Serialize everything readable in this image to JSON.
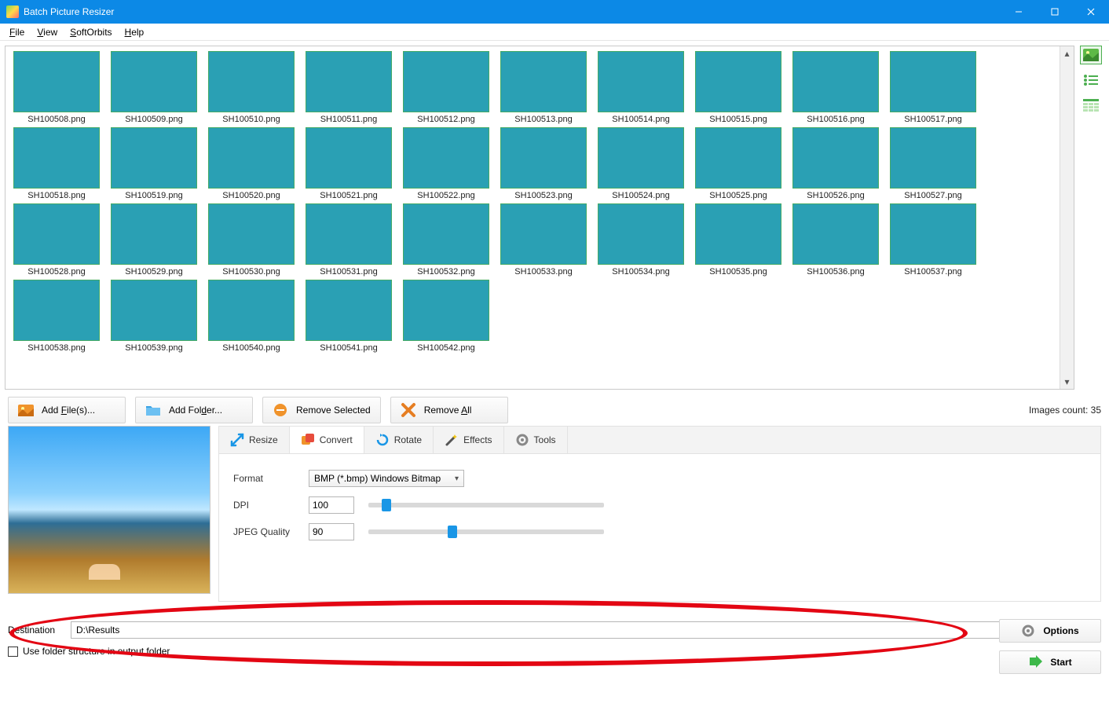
{
  "window": {
    "title": "Batch Picture Resizer"
  },
  "menu": {
    "file": "File",
    "view": "View",
    "softorbits": "SoftOrbits",
    "help": "Help"
  },
  "thumbnails": [
    {
      "name": "SH100508.png",
      "cls": "beach"
    },
    {
      "name": "SH100509.png",
      "cls": "sky"
    },
    {
      "name": "SH100510.png",
      "cls": "beach2"
    },
    {
      "name": "SH100511.png",
      "cls": "beach"
    },
    {
      "name": "SH100512.png",
      "cls": "beach"
    },
    {
      "name": "SH100513.png",
      "cls": "beach2"
    },
    {
      "name": "SH100514.png",
      "cls": "beach2"
    },
    {
      "name": "SH100515.png",
      "cls": "pier"
    },
    {
      "name": "SH100516.png",
      "cls": "water"
    },
    {
      "name": "SH100517.png",
      "cls": "water2"
    },
    {
      "name": "SH100518.png",
      "cls": "water"
    },
    {
      "name": "SH100519.png",
      "cls": "water2"
    },
    {
      "name": "SH100520.png",
      "cls": "water"
    },
    {
      "name": "SH100521.png",
      "cls": "water2"
    },
    {
      "name": "SH100522.png",
      "cls": "water"
    },
    {
      "name": "SH100523.png",
      "cls": "water2"
    },
    {
      "name": "SH100524.png",
      "cls": "water"
    },
    {
      "name": "SH100525.png",
      "cls": "water2"
    },
    {
      "name": "SH100526.png",
      "cls": "water"
    },
    {
      "name": "SH100527.png",
      "cls": "water2"
    },
    {
      "name": "SH100528.png",
      "cls": "water"
    },
    {
      "name": "SH100529.png",
      "cls": "pier"
    },
    {
      "name": "SH100530.png",
      "cls": "people"
    },
    {
      "name": "SH100531.png",
      "cls": "people"
    },
    {
      "name": "SH100532.png",
      "cls": "reef"
    },
    {
      "name": "SH100533.png",
      "cls": "reef"
    },
    {
      "name": "SH100534.png",
      "cls": "people"
    },
    {
      "name": "SH100535.png",
      "cls": "people"
    },
    {
      "name": "SH100536.png",
      "cls": "shore"
    },
    {
      "name": "SH100537.png",
      "cls": "people"
    },
    {
      "name": "SH100538.png",
      "cls": "people"
    },
    {
      "name": "SH100539.png",
      "cls": "people"
    },
    {
      "name": "SH100540.png",
      "cls": "reef"
    },
    {
      "name": "SH100541.png",
      "cls": "water"
    },
    {
      "name": "SH100542.png",
      "cls": "water2"
    }
  ],
  "toolbar": {
    "add_files": "Add File(s)...",
    "add_folder": "Add Folder...",
    "remove_selected": "Remove Selected",
    "remove_all": "Remove All",
    "images_count_label": "Images count: 35"
  },
  "tabs": {
    "resize": "Resize",
    "convert": "Convert",
    "rotate": "Rotate",
    "effects": "Effects",
    "tools": "Tools"
  },
  "convert": {
    "format_label": "Format",
    "format_value": "BMP (*.bmp) Windows Bitmap",
    "dpi_label": "DPI",
    "dpi_value": "100",
    "dpi_slider_pct": 6,
    "jpeg_label": "JPEG Quality",
    "jpeg_value": "90",
    "jpeg_slider_pct": 35
  },
  "destination": {
    "label": "Destination",
    "value": "D:\\Results",
    "use_folder_structure": "Use folder structure in output folder"
  },
  "actions": {
    "options": "Options",
    "start": "Start"
  },
  "colors": {
    "accent": "#0c89e6",
    "start_green": "#3db84a",
    "anno_red": "#e30613"
  }
}
